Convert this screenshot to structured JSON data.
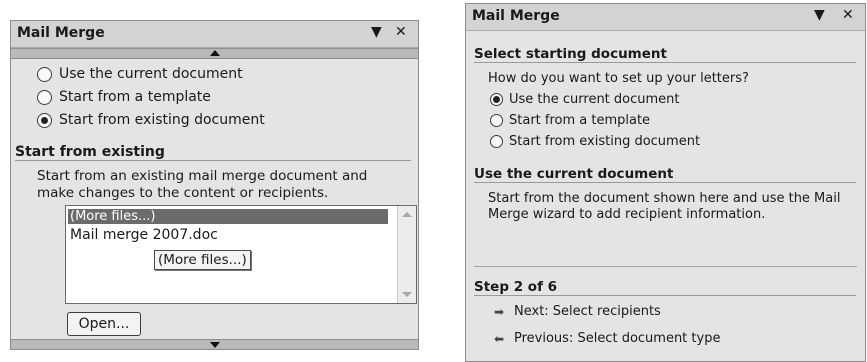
{
  "left_pane": {
    "title": "Mail Merge",
    "dropdown_glyph": "▼",
    "close_glyph": "✕",
    "options": [
      {
        "label": "Use the current document",
        "checked": false
      },
      {
        "label": "Start from a template",
        "checked": false
      },
      {
        "label": "Start from existing document",
        "checked": true
      }
    ],
    "section_heading": "Start from existing",
    "section_desc_line1": "Start from an existing mail merge document and",
    "section_desc_line2": "make changes to the content or recipients.",
    "list": {
      "selected_item": "(More files...)",
      "items": [
        "Mail merge 2007.doc"
      ]
    },
    "tooltip": "(More files...)",
    "open_button": "Open..."
  },
  "right_pane": {
    "title": "Mail Merge",
    "dropdown_glyph": "▼",
    "close_glyph": "✕",
    "heading_select": "Select starting document",
    "question": "How do you want to set up your letters?",
    "options": [
      {
        "label": "Use the current document",
        "checked": true
      },
      {
        "label": "Start from a template",
        "checked": false
      },
      {
        "label": "Start from existing document",
        "checked": false
      }
    ],
    "heading_use": "Use the current document",
    "use_desc_line1": "Start from the document shown here and use the Mail",
    "use_desc_line2": "Merge wizard to add recipient information.",
    "step": "Step 2 of 6",
    "next_arrow": "➡",
    "next_label": "Next: Select recipients",
    "prev_arrow": "⬅",
    "prev_label": "Previous: Select document type"
  }
}
